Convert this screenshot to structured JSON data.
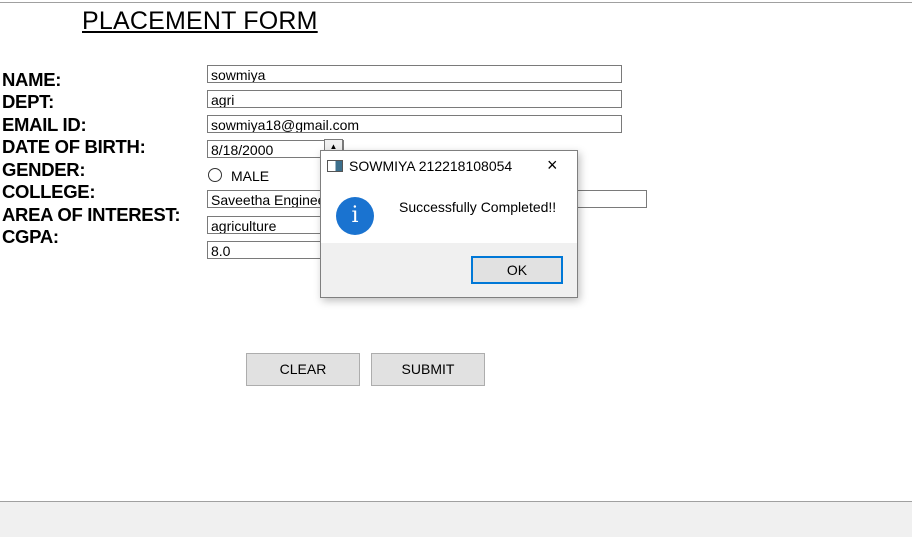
{
  "form": {
    "title": "PLACEMENT FORM",
    "labels": {
      "name": "NAME:",
      "dept": "DEPT:",
      "email": "EMAIL ID:",
      "dob": "DATE OF BIRTH:",
      "gender": "GENDER:",
      "college": "COLLEGE:",
      "interest": "AREA OF INTEREST:",
      "cgpa": "CGPA:"
    },
    "values": {
      "name": "sowmiya",
      "dept": "agri",
      "email": "sowmiya18@gmail.com",
      "dob": "8/18/2000",
      "gender_option": "MALE",
      "college": "Saveetha Engineering College",
      "interest": "agriculture",
      "cgpa": "8.0"
    },
    "buttons": {
      "clear": "CLEAR",
      "submit": "SUBMIT"
    }
  },
  "dialog": {
    "title": "SOWMIYA 212218108054",
    "close": "×",
    "message": "Successfully Completed!!",
    "ok": "OK",
    "icon": "info-icon"
  }
}
